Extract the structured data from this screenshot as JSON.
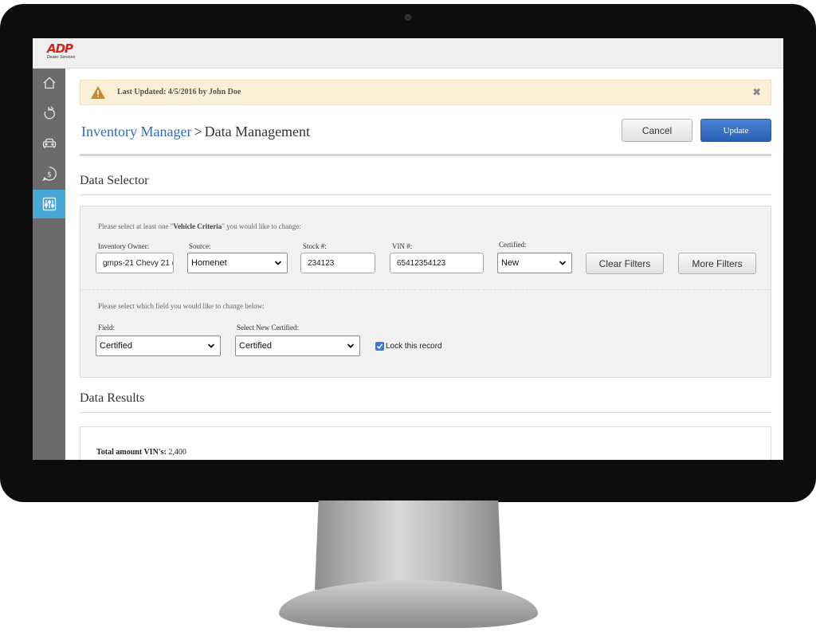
{
  "brand": {
    "logo_text": "ADP",
    "logo_sub": "Dealer Services"
  },
  "sidebar": {
    "items": [
      {
        "icon": "home-icon"
      },
      {
        "icon": "refresh-icon"
      },
      {
        "icon": "car-icon"
      },
      {
        "icon": "dollar-icon"
      },
      {
        "icon": "sliders-icon",
        "active": true
      }
    ]
  },
  "alert": {
    "text": "Last Updated: 4/5/2016 by John Doe",
    "close": "✖"
  },
  "header": {
    "breadcrumb_link": "Inventory Manager",
    "breadcrumb_sep": ">",
    "breadcrumb_current": "Data Management",
    "cancel_label": "Cancel",
    "update_label": "Update"
  },
  "selector": {
    "title": "Data Selector",
    "hint_prefix": "Please select at least one \"",
    "hint_bold": "Vehicle Criteria",
    "hint_suffix": "\" you would like to change:",
    "inventory_owner": {
      "label": "Inventory Owner:",
      "value": "gmps-21 Chevy 21 (c"
    },
    "source": {
      "label": "Source:",
      "value": "Homenet"
    },
    "stock": {
      "label": "Stock #:",
      "value": "234123"
    },
    "vin": {
      "label": "VIN #:",
      "value": "65412354123"
    },
    "certified": {
      "label": "Certified:",
      "value": "New"
    },
    "clear_filters": "Clear Filters",
    "more_filters": "More Filters",
    "change_hint": "Please select which field you would like to change below:",
    "field": {
      "label": "Field:",
      "value": "Certified"
    },
    "new_certified": {
      "label": "Select New Certified:",
      "value": "Certified"
    },
    "lock_label": "Lock this record",
    "lock_checked": true
  },
  "results": {
    "title": "Data Results",
    "total_label": "Total amount VIN's:",
    "total_value": "2,400"
  },
  "colors": {
    "accent": "#2f6bbf",
    "sidebar": "#6b6b6b",
    "sidebar_active": "#47a8d8",
    "alert_bg": "#fbf0d7",
    "update_btn": "#2a61b5"
  }
}
